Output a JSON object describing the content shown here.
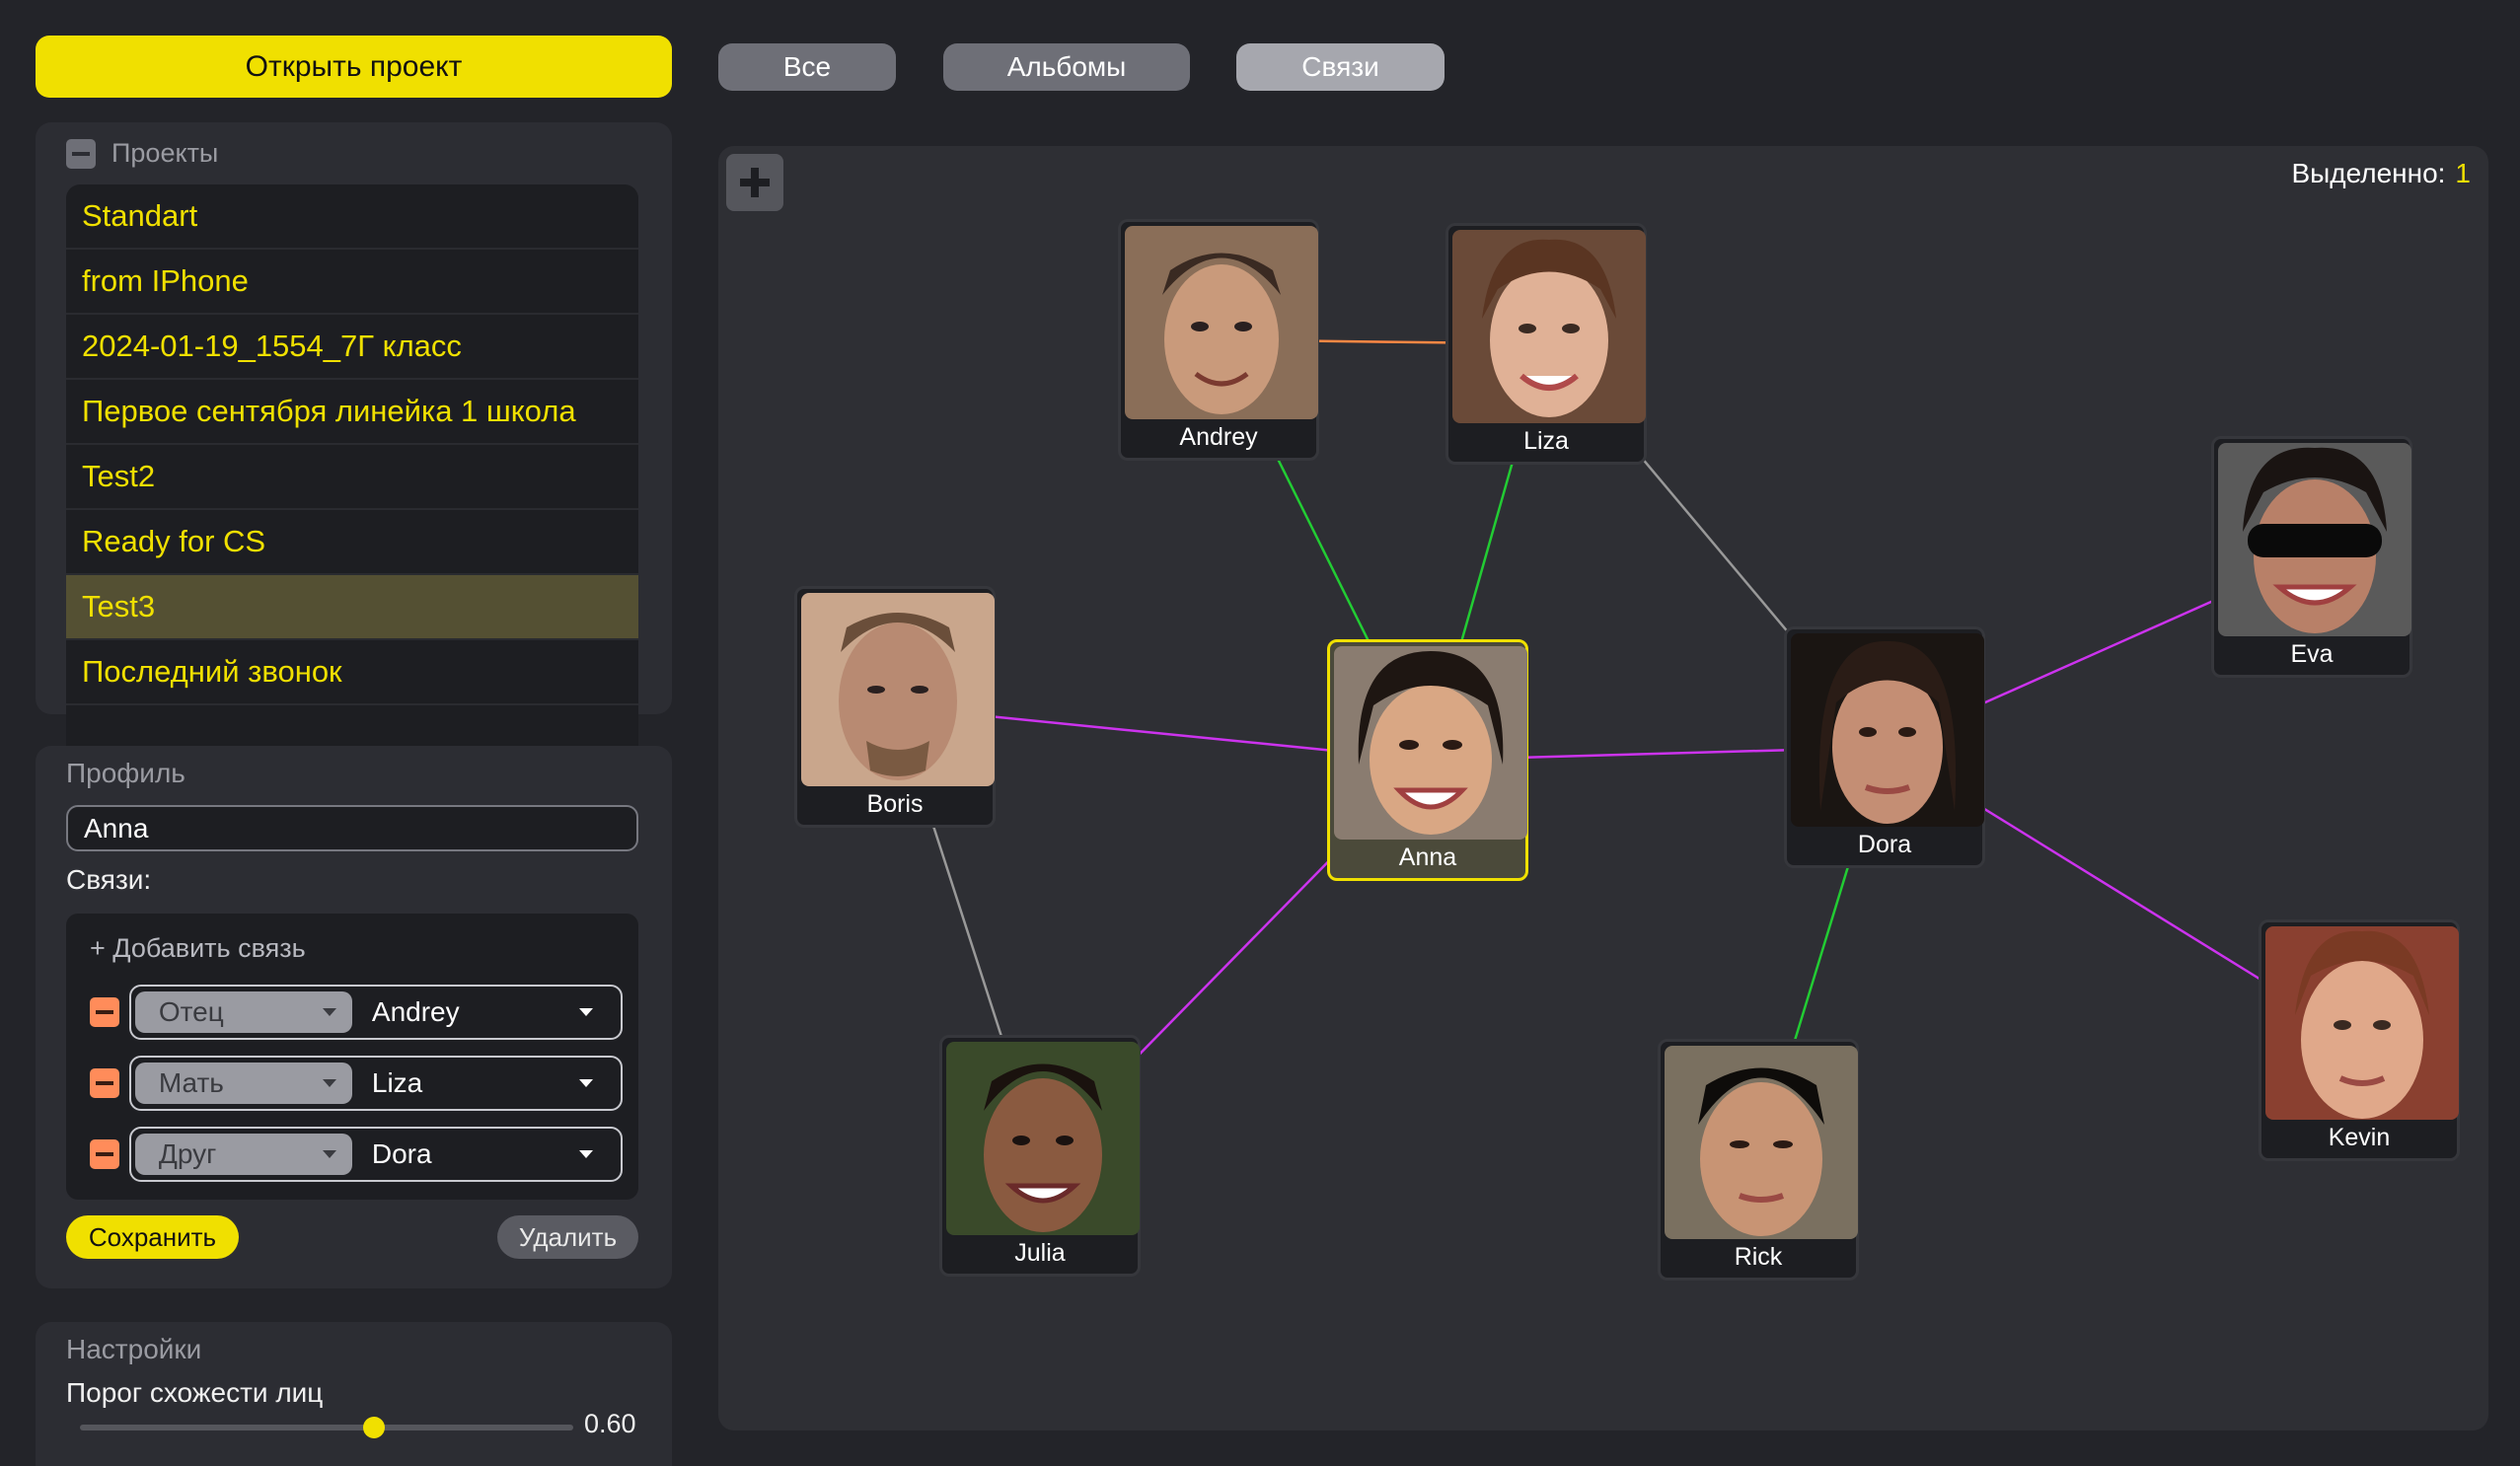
{
  "sidebar": {
    "open_project": "Открыть проект",
    "projects": {
      "title": "Проекты",
      "items": [
        {
          "label": "Standart",
          "selected": false
        },
        {
          "label": "from IPhone",
          "selected": false
        },
        {
          "label": "2024-01-19_1554_7Г класс",
          "selected": false
        },
        {
          "label": "Первое сентября линейка 1 школа",
          "selected": false
        },
        {
          "label": "Test2",
          "selected": false
        },
        {
          "label": "Ready for CS",
          "selected": false
        },
        {
          "label": "Test3",
          "selected": true
        },
        {
          "label": "Последний звонок",
          "selected": false
        }
      ]
    },
    "profile": {
      "title": "Профиль",
      "name": "Anna",
      "links_label": "Связи:",
      "add_link": "+ Добавить связь",
      "relations": [
        {
          "type": "Отец",
          "person": "Andrey"
        },
        {
          "type": "Мать",
          "person": "Liza"
        },
        {
          "type": "Друг",
          "person": "Dora"
        }
      ],
      "save": "Сохранить",
      "delete": "Удалить"
    },
    "settings": {
      "title": "Настройки",
      "threshold_label": "Порог схожести лиц",
      "threshold_value": "0.60",
      "threshold_fraction": 0.6
    }
  },
  "tabs": [
    {
      "label": "Все",
      "active": false
    },
    {
      "label": "Альбомы",
      "active": false
    },
    {
      "label": "Связи",
      "active": true
    }
  ],
  "graph": {
    "selected_label": "Выделенно:",
    "selected_count": "1",
    "colors": {
      "accent": "#f0e000",
      "parent": "#22cc33",
      "friend": "#cc33ee",
      "other": "#999999",
      "spouse": "#ff8844"
    },
    "people": [
      {
        "id": "andrey",
        "name": "Andrey",
        "selected": false
      },
      {
        "id": "liza",
        "name": "Liza",
        "selected": false
      },
      {
        "id": "boris",
        "name": "Boris",
        "selected": false
      },
      {
        "id": "anna",
        "name": "Anna",
        "selected": true
      },
      {
        "id": "dora",
        "name": "Dora",
        "selected": false
      },
      {
        "id": "eva",
        "name": "Eva",
        "selected": false
      },
      {
        "id": "julia",
        "name": "Julia",
        "selected": false
      },
      {
        "id": "rick",
        "name": "Rick",
        "selected": false
      },
      {
        "id": "kevin",
        "name": "Kevin",
        "selected": false
      }
    ],
    "links": [
      {
        "from": "andrey",
        "to": "liza",
        "kind": "spouse"
      },
      {
        "from": "andrey",
        "to": "anna",
        "kind": "parent"
      },
      {
        "from": "liza",
        "to": "anna",
        "kind": "parent"
      },
      {
        "from": "liza",
        "to": "dora",
        "kind": "other"
      },
      {
        "from": "boris",
        "to": "anna",
        "kind": "friend"
      },
      {
        "from": "boris",
        "to": "julia",
        "kind": "other"
      },
      {
        "from": "anna",
        "to": "dora",
        "kind": "friend"
      },
      {
        "from": "anna",
        "to": "julia",
        "kind": "friend"
      },
      {
        "from": "dora",
        "to": "eva",
        "kind": "friend"
      },
      {
        "from": "dora",
        "to": "kevin",
        "kind": "friend"
      },
      {
        "from": "dora",
        "to": "rick",
        "kind": "parent"
      }
    ]
  }
}
